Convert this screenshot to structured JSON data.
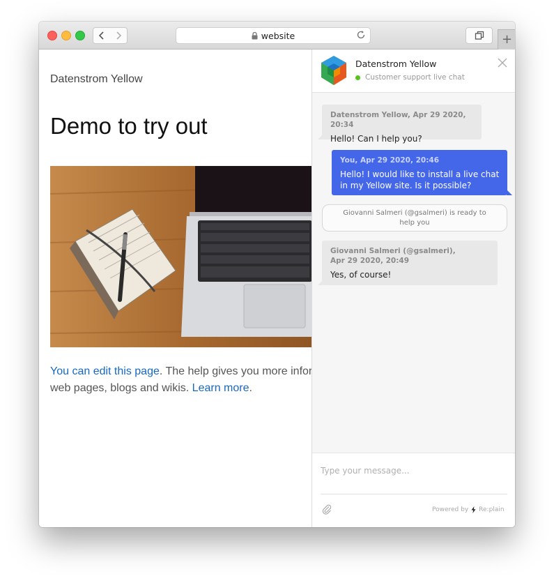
{
  "browser": {
    "url": "website",
    "icons": {
      "back": "chevron-left-icon",
      "forward": "chevron-right-icon",
      "lock": "lock-icon",
      "reload": "reload-icon",
      "tabs": "tabs-overview-icon",
      "new_tab": "plus-icon"
    },
    "new_tab_label": "+"
  },
  "page": {
    "site_name": "Datenstrom Yellow",
    "heading": "Demo to try out",
    "paragraph": {
      "link1": "You can edit this page",
      "text1": ". The help gives you more infor",
      "text2": "web pages, blogs and wikis. ",
      "link2": "Learn more",
      "text3": "."
    },
    "link_color": "#1668c5"
  },
  "chat": {
    "title": "Datenstrom Yellow",
    "status": "Customer support live chat",
    "status_color": "#52c41a",
    "messages": [
      {
        "meta": "Datenstrom Yellow, Apr 29 2020, 20:34",
        "text": "Hello! Can I help you?"
      },
      {
        "meta": "You, Apr 29 2020, 20:46",
        "text": "Hello! I would like to install a live chat in my Yellow site. Is it possible?"
      },
      {
        "text": "Giovanni Salmeri (@gsalmeri) is ready to help you"
      },
      {
        "meta": "Giovanni Salmeri (@gsalmeri), Apr 29 2020, 20:49",
        "text": "Yes, of course!"
      }
    ],
    "input_placeholder": "Type your message...",
    "powered_by": "Powered by",
    "brand": "Re:plain",
    "outgoing_color": "#4466e8",
    "incoming_color": "#e8e8e8"
  }
}
